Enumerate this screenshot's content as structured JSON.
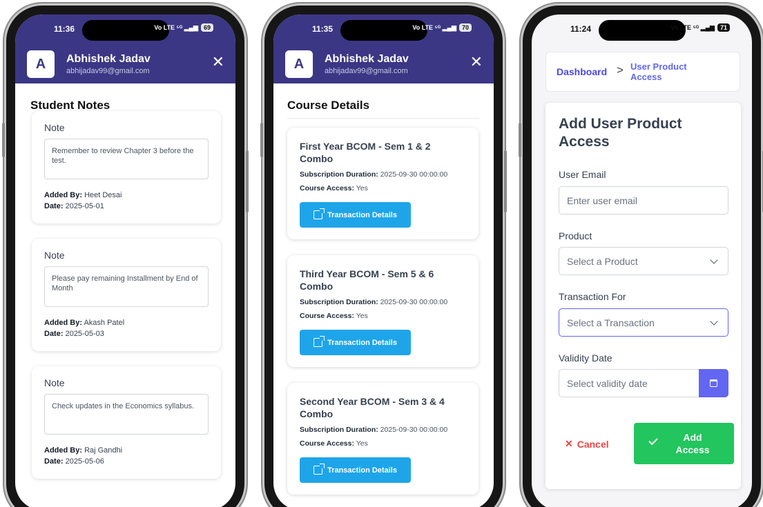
{
  "notes_screen": {
    "status": {
      "time": "11:36",
      "network": "Vo LTE ⁵ᴳ ▂▄▆",
      "battery": "69"
    },
    "header": {
      "avatar_letter": "A",
      "name": "Abhishek Jadav",
      "email": "abhijadav99@gmail.com",
      "close": "✕"
    },
    "title": "Student Notes",
    "notes": [
      {
        "label": "Note",
        "text": "Remember to review Chapter 3 before the test.",
        "added_by_label": "Added By:",
        "added_by": "Heet Desai",
        "date_label": "Date:",
        "date": "2025-05-01"
      },
      {
        "label": "Note",
        "text": "Please pay remaining Installment by End of Month",
        "added_by_label": "Added By:",
        "added_by": "Akash Patel",
        "date_label": "Date:",
        "date": "2025-05-03"
      },
      {
        "label": "Note",
        "text": "Check updates in the Economics syllabus.",
        "added_by_label": "Added By:",
        "added_by": "Raj Gandhi",
        "date_label": "Date:",
        "date": "2025-05-06"
      }
    ]
  },
  "courses_screen": {
    "status": {
      "time": "11:35",
      "network": "Vo LTE ⁵ᴳ ▂▄▆",
      "battery": "70"
    },
    "header": {
      "avatar_letter": "A",
      "name": "Abhishek Jadav",
      "email": "abhijadav99@gmail.com",
      "close": "✕"
    },
    "title": "Course Details",
    "courses": [
      {
        "title": "First Year BCOM - Sem 1 & 2 Combo",
        "duration_label": "Subscription Duration:",
        "duration": "2025-09-30 00:00:00",
        "access_label": "Course Access:",
        "access": "Yes",
        "button": "Transaction Details"
      },
      {
        "title": "Third Year BCOM - Sem 5 & 6 Combo",
        "duration_label": "Subscription Duration:",
        "duration": "2025-09-30 00:00:00",
        "access_label": "Course Access:",
        "access": "Yes",
        "button": "Transaction Details"
      },
      {
        "title": "Second Year BCOM - Sem 3 & 4 Combo",
        "duration_label": "Subscription Duration:",
        "duration": "2025-09-30 00:00:00",
        "access_label": "Course Access:",
        "access": "Yes",
        "button": "Transaction Details"
      }
    ]
  },
  "access_screen": {
    "status": {
      "time": "11:24",
      "network": "Vo LTE ⁵ᴳ ▂▄▆",
      "battery": "71"
    },
    "breadcrumb": {
      "root": "Dashboard",
      "separator": ">",
      "current": "User Product Access"
    },
    "title": "Add User Product Access",
    "fields": {
      "email_label": "User Email",
      "email_placeholder": "Enter user email",
      "product_label": "Product",
      "product_value": "Select a Product",
      "transaction_label": "Transaction For",
      "transaction_value": "Select a Transaction",
      "validity_label": "Validity Date",
      "validity_placeholder": "Select validity date"
    },
    "cancel_icon": "✕",
    "cancel": "Cancel",
    "submit": "Add Access"
  },
  "colors": {
    "header": "#3b3785",
    "primary": "#1ea5e9",
    "accent": "#6366f1",
    "success": "#22c55e",
    "danger": "#ef4444"
  },
  "icons": [
    "close-icon",
    "external-link-icon",
    "chevron-down-icon",
    "calendar-icon",
    "check-icon"
  ]
}
